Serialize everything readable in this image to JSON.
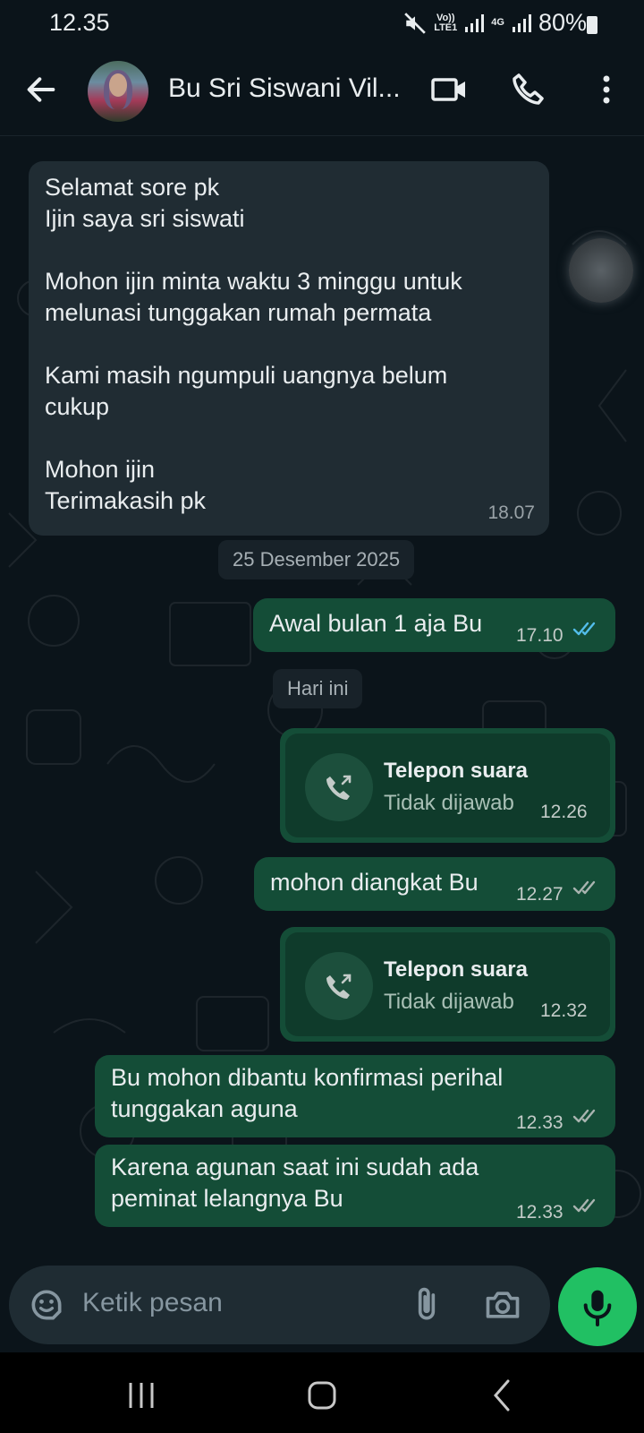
{
  "status_bar": {
    "time": "12.35",
    "volte": "Vo))",
    "lte": "LTE1",
    "net": "4G",
    "battery": "80%"
  },
  "header": {
    "contact_name": "Bu Sri Siswani Vil..."
  },
  "messages": {
    "m1": {
      "lines": [
        "Selamat sore pk",
        "Ijin  saya sri siswati",
        "",
        "Mohon ijin minta waktu 3 minggu untuk",
        "melunasi tunggakan rumah permata",
        "",
        "Kami masih ngumpuli uangnya belum",
        "cukup",
        "",
        "Mohon ijin",
        "Terimakasih  pk"
      ],
      "time": "18.07"
    },
    "date1": "25 Desember 2025",
    "m2": {
      "text": "Awal bulan 1 aja Bu",
      "time": "17.10",
      "status": "read"
    },
    "date2": "Hari ini",
    "call1": {
      "title": "Telepon suara",
      "subtitle": "Tidak dijawab",
      "time": "12.26"
    },
    "m3": {
      "text": "mohon diangkat Bu",
      "time": "12.27",
      "status": "delivered"
    },
    "call2": {
      "title": "Telepon suara",
      "subtitle": "Tidak dijawab",
      "time": "12.32"
    },
    "m4": {
      "line1": "Bu mohon dibantu konfirmasi perihal",
      "line2": "tunggakan aguna",
      "time": "12.33",
      "status": "delivered"
    },
    "m5": {
      "line1": "Karena agunan saat ini sudah ada",
      "line2": "peminat lelangnya Bu",
      "time": "12.33",
      "status": "delivered"
    }
  },
  "input": {
    "placeholder": "Ketik pesan"
  },
  "colors": {
    "background": "#0b141a",
    "incoming_bubble": "#202c33",
    "outgoing_bubble": "#144d37",
    "read_tick": "#53bdeb",
    "mic_button": "#21c063"
  },
  "icons": [
    "back-arrow-icon",
    "video-call-icon",
    "phone-icon",
    "more-vert-icon",
    "emoji-icon",
    "attach-icon",
    "camera-icon",
    "mic-icon",
    "missed-call-icon",
    "recents-icon",
    "home-icon",
    "nav-back-icon"
  ]
}
